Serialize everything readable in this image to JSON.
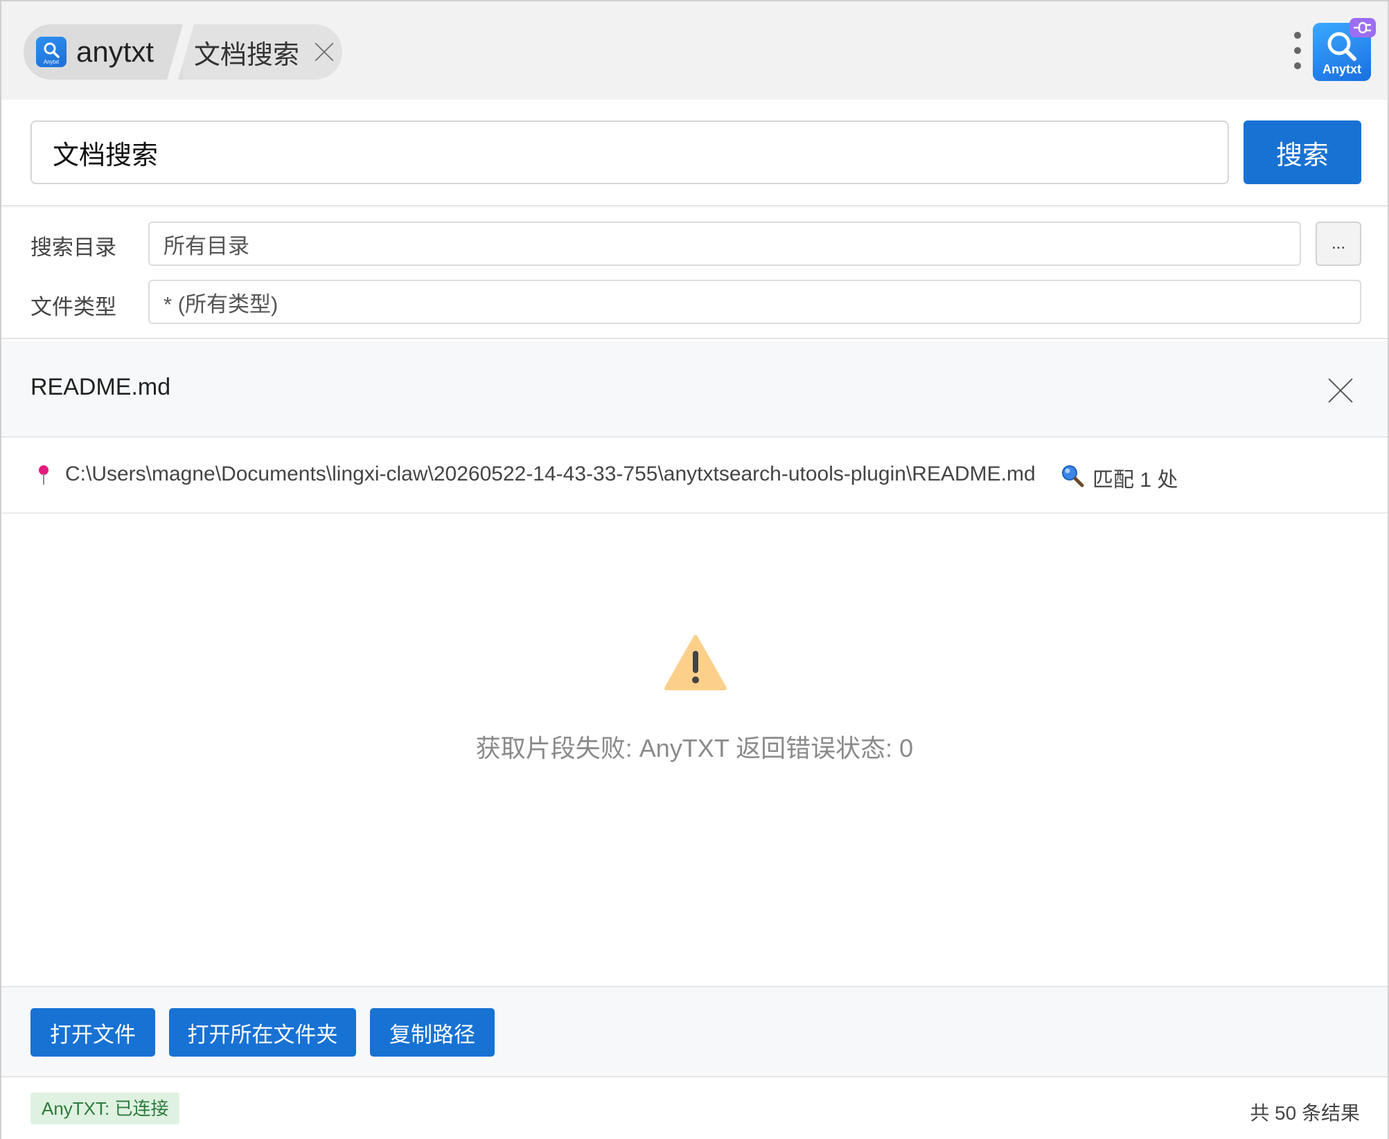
{
  "app": {
    "name": "anytxt",
    "icon_text": "Anytxt",
    "plugin_badge": "plug-icon"
  },
  "tab": {
    "label": "文档搜索"
  },
  "search": {
    "value": "文档搜索",
    "button_label": "搜索"
  },
  "filters": {
    "dir_label": "搜索目录",
    "dir_value": "所有目录",
    "browse_label": "...",
    "type_label": "文件类型",
    "type_value": "* (所有类型)"
  },
  "detail": {
    "file_name": "README.md",
    "path": "C:\\Users\\magne\\Documents\\lingxi-claw\\20260522-14-43-33-755\\anytxtsearch-utools-plugin\\README.md",
    "match_text": "匹配 1 处",
    "error_message": "获取片段失败: AnyTXT 返回错误状态: 0"
  },
  "actions": {
    "open_file": "打开文件",
    "open_folder": "打开所在文件夹",
    "copy_path": "复制路径"
  },
  "status": {
    "connection": "AnyTXT: 已连接",
    "result_count": "共 50 条结果"
  },
  "colors": {
    "accent": "#1872d4",
    "warning": "#fcd08a",
    "status_bg": "#dff2e2",
    "pin": "#e6197e"
  }
}
